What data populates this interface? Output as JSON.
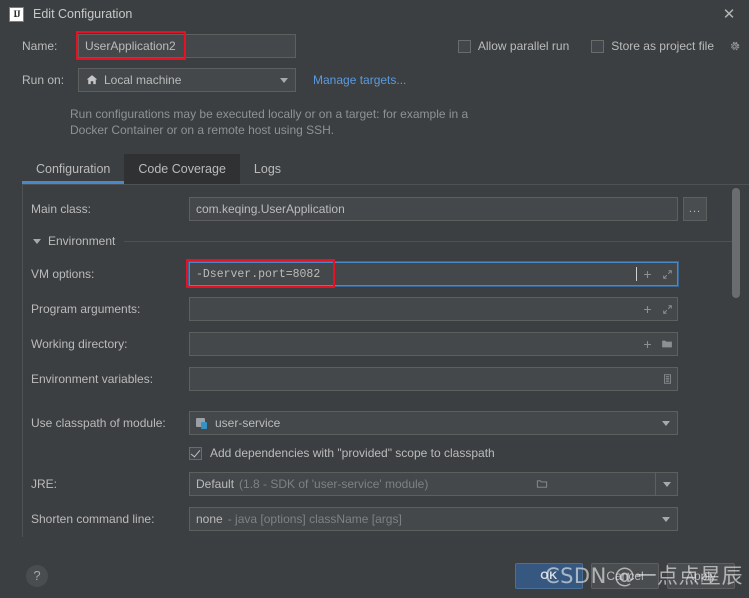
{
  "window": {
    "title": "Edit Configuration",
    "app_icon": "intellij-idea-icon",
    "close_icon": "close-icon"
  },
  "header": {
    "name_label": "Name:",
    "name_value": "UserApplication2",
    "name_placeholder": "",
    "run_on_label": "Run on:",
    "run_on_value": "Local machine",
    "run_on_icon": "home-icon",
    "manage_targets_link": "Manage targets...",
    "allow_parallel_run_label": "Allow parallel run",
    "allow_parallel_run_checked": false,
    "store_as_project_file_label": "Store as project file",
    "store_as_project_file_checked": false,
    "store_gear_icon": "gear-icon",
    "description": "Run configurations may be executed locally or on a target: for example in a Docker Container or on a remote host using SSH."
  },
  "tabs": [
    {
      "label": "Configuration",
      "active": true
    },
    {
      "label": "Code Coverage",
      "active": false
    },
    {
      "label": "Logs",
      "active": false
    }
  ],
  "form": {
    "main_class_label": "Main class:",
    "main_class_value": "com.keqing.UserApplication",
    "main_class_browse": "...",
    "environment_section_label": "Environment",
    "vm_options_label": "VM options:",
    "vm_options_value": "-Dserver.port=8082",
    "program_arguments_label": "Program arguments:",
    "program_arguments_value": "",
    "working_directory_label": "Working directory:",
    "working_directory_value": "",
    "environment_variables_label": "Environment variables:",
    "environment_variables_value": "",
    "use_classpath_label": "Use classpath of module:",
    "use_classpath_value": "user-service",
    "add_dependencies_label": "Add dependencies with \"provided\" scope to classpath",
    "add_dependencies_checked": true,
    "jre_label": "JRE:",
    "jre_value": "Default",
    "jre_value_hint": "(1.8 - SDK of 'user-service' module)",
    "shorten_label": "Shorten command line:",
    "shorten_value": "none",
    "shorten_value_hint": "- java [options] className [args]"
  },
  "icons": {
    "macro_plus": "+",
    "expand": "expand-icon",
    "folder": "folder-icon",
    "env_list": "list-icon"
  },
  "footer": {
    "help_label": "?",
    "ok_label": "OK",
    "cancel_label": "Cancel",
    "apply_label": "Apply"
  },
  "watermark": {
    "text": "CSDN @一点点星辰"
  },
  "colors": {
    "dialog_bg": "#3c3f41",
    "field_bg": "#45484a",
    "accent_blue": "#4a88c7",
    "link_blue": "#5a9ae0",
    "primary_button": "#365880",
    "annotation_red": "#e81123",
    "text": "#bbbbbb",
    "dim_text": "#7e8184"
  }
}
